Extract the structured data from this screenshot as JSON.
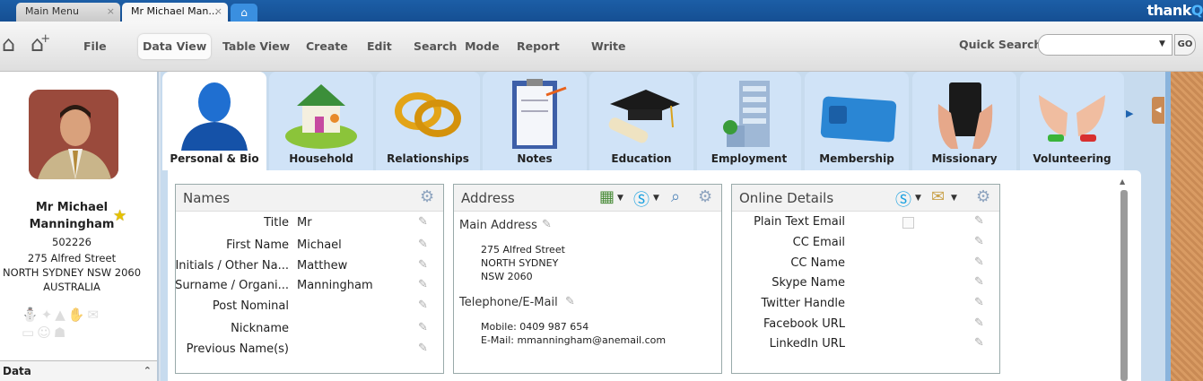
{
  "tabs": [
    {
      "label": "Main Menu"
    },
    {
      "label": "Mr Michael Man..."
    }
  ],
  "tab_close": "×",
  "brand": {
    "name": "thank",
    "accent": "Q"
  },
  "toolbar": {
    "menus": [
      "File",
      "Data View",
      "Table View",
      "Create",
      "Edit",
      "Search  Mode",
      "Report",
      "Write"
    ],
    "quick_search_label": "Quick Search",
    "quick_search_value": "",
    "go_label": "GO"
  },
  "person": {
    "name": "Mr Michael Manningham",
    "id": "502226",
    "address_line1": "275 Alfred Street",
    "address_line2": "NORTH SYDNEY NSW 2060",
    "address_line3": "AUSTRALIA"
  },
  "sidebar": {
    "section_label": "Data"
  },
  "categories": [
    {
      "label": "Personal & Bio",
      "icon": "person-icon"
    },
    {
      "label": "Household",
      "icon": "house-icon"
    },
    {
      "label": "Relationships",
      "icon": "rings-icon"
    },
    {
      "label": "Notes",
      "icon": "clipboard-icon"
    },
    {
      "label": "Education",
      "icon": "graduation-cap-icon"
    },
    {
      "label": "Employment",
      "icon": "office-building-icon"
    },
    {
      "label": "Membership",
      "icon": "membership-card-icon"
    },
    {
      "label": "Missionary",
      "icon": "bible-icon"
    },
    {
      "label": "Volunteering",
      "icon": "helping-hands-icon"
    }
  ],
  "names_panel": {
    "title": "Names",
    "rows": [
      {
        "label": "Title",
        "value": "Mr"
      },
      {
        "label": "First Name",
        "value": "Michael"
      },
      {
        "label": "Initials / Other Na...",
        "value": "Matthew"
      },
      {
        "label": "Surname / Organi...",
        "value": "Manningham"
      },
      {
        "label": "Post Nominal",
        "value": ""
      },
      {
        "label": "Nickname",
        "value": ""
      },
      {
        "label": "Previous Name(s)",
        "value": ""
      }
    ]
  },
  "address_panel": {
    "title": "Address",
    "main_label": "Main Address",
    "main_lines": [
      "275 Alfred Street",
      "NORTH SYDNEY",
      "NSW 2060"
    ],
    "tel_label": "Telephone/E-Mail",
    "tel_lines": [
      "Mobile: 0409 987 654",
      "E-Mail: mmanningham@anemail.com"
    ]
  },
  "online_panel": {
    "title": "Online Details",
    "rows": [
      {
        "label": "Plain Text Email"
      },
      {
        "label": "CC Email"
      },
      {
        "label": "CC Name"
      },
      {
        "label": "Skype Name"
      },
      {
        "label": "Twitter Handle"
      },
      {
        "label": "Facebook URL"
      },
      {
        "label": "LinkedIn URL"
      }
    ]
  }
}
